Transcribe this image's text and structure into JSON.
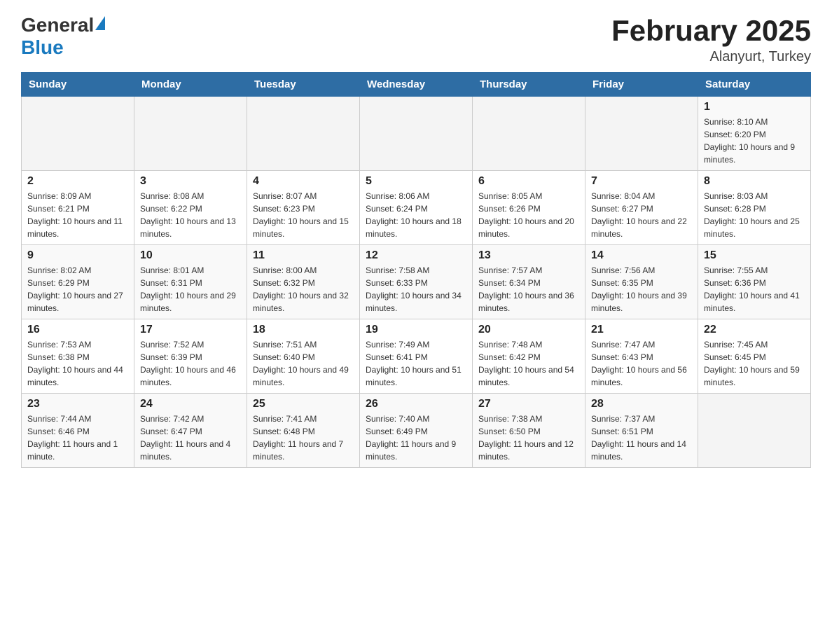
{
  "header": {
    "logo_general": "General",
    "logo_blue": "Blue",
    "title": "February 2025",
    "subtitle": "Alanyurt, Turkey"
  },
  "weekdays": [
    "Sunday",
    "Monday",
    "Tuesday",
    "Wednesday",
    "Thursday",
    "Friday",
    "Saturday"
  ],
  "weeks": [
    [
      {
        "day": "",
        "info": ""
      },
      {
        "day": "",
        "info": ""
      },
      {
        "day": "",
        "info": ""
      },
      {
        "day": "",
        "info": ""
      },
      {
        "day": "",
        "info": ""
      },
      {
        "day": "",
        "info": ""
      },
      {
        "day": "1",
        "info": "Sunrise: 8:10 AM\nSunset: 6:20 PM\nDaylight: 10 hours and 9 minutes."
      }
    ],
    [
      {
        "day": "2",
        "info": "Sunrise: 8:09 AM\nSunset: 6:21 PM\nDaylight: 10 hours and 11 minutes."
      },
      {
        "day": "3",
        "info": "Sunrise: 8:08 AM\nSunset: 6:22 PM\nDaylight: 10 hours and 13 minutes."
      },
      {
        "day": "4",
        "info": "Sunrise: 8:07 AM\nSunset: 6:23 PM\nDaylight: 10 hours and 15 minutes."
      },
      {
        "day": "5",
        "info": "Sunrise: 8:06 AM\nSunset: 6:24 PM\nDaylight: 10 hours and 18 minutes."
      },
      {
        "day": "6",
        "info": "Sunrise: 8:05 AM\nSunset: 6:26 PM\nDaylight: 10 hours and 20 minutes."
      },
      {
        "day": "7",
        "info": "Sunrise: 8:04 AM\nSunset: 6:27 PM\nDaylight: 10 hours and 22 minutes."
      },
      {
        "day": "8",
        "info": "Sunrise: 8:03 AM\nSunset: 6:28 PM\nDaylight: 10 hours and 25 minutes."
      }
    ],
    [
      {
        "day": "9",
        "info": "Sunrise: 8:02 AM\nSunset: 6:29 PM\nDaylight: 10 hours and 27 minutes."
      },
      {
        "day": "10",
        "info": "Sunrise: 8:01 AM\nSunset: 6:31 PM\nDaylight: 10 hours and 29 minutes."
      },
      {
        "day": "11",
        "info": "Sunrise: 8:00 AM\nSunset: 6:32 PM\nDaylight: 10 hours and 32 minutes."
      },
      {
        "day": "12",
        "info": "Sunrise: 7:58 AM\nSunset: 6:33 PM\nDaylight: 10 hours and 34 minutes."
      },
      {
        "day": "13",
        "info": "Sunrise: 7:57 AM\nSunset: 6:34 PM\nDaylight: 10 hours and 36 minutes."
      },
      {
        "day": "14",
        "info": "Sunrise: 7:56 AM\nSunset: 6:35 PM\nDaylight: 10 hours and 39 minutes."
      },
      {
        "day": "15",
        "info": "Sunrise: 7:55 AM\nSunset: 6:36 PM\nDaylight: 10 hours and 41 minutes."
      }
    ],
    [
      {
        "day": "16",
        "info": "Sunrise: 7:53 AM\nSunset: 6:38 PM\nDaylight: 10 hours and 44 minutes."
      },
      {
        "day": "17",
        "info": "Sunrise: 7:52 AM\nSunset: 6:39 PM\nDaylight: 10 hours and 46 minutes."
      },
      {
        "day": "18",
        "info": "Sunrise: 7:51 AM\nSunset: 6:40 PM\nDaylight: 10 hours and 49 minutes."
      },
      {
        "day": "19",
        "info": "Sunrise: 7:49 AM\nSunset: 6:41 PM\nDaylight: 10 hours and 51 minutes."
      },
      {
        "day": "20",
        "info": "Sunrise: 7:48 AM\nSunset: 6:42 PM\nDaylight: 10 hours and 54 minutes."
      },
      {
        "day": "21",
        "info": "Sunrise: 7:47 AM\nSunset: 6:43 PM\nDaylight: 10 hours and 56 minutes."
      },
      {
        "day": "22",
        "info": "Sunrise: 7:45 AM\nSunset: 6:45 PM\nDaylight: 10 hours and 59 minutes."
      }
    ],
    [
      {
        "day": "23",
        "info": "Sunrise: 7:44 AM\nSunset: 6:46 PM\nDaylight: 11 hours and 1 minute."
      },
      {
        "day": "24",
        "info": "Sunrise: 7:42 AM\nSunset: 6:47 PM\nDaylight: 11 hours and 4 minutes."
      },
      {
        "day": "25",
        "info": "Sunrise: 7:41 AM\nSunset: 6:48 PM\nDaylight: 11 hours and 7 minutes."
      },
      {
        "day": "26",
        "info": "Sunrise: 7:40 AM\nSunset: 6:49 PM\nDaylight: 11 hours and 9 minutes."
      },
      {
        "day": "27",
        "info": "Sunrise: 7:38 AM\nSunset: 6:50 PM\nDaylight: 11 hours and 12 minutes."
      },
      {
        "day": "28",
        "info": "Sunrise: 7:37 AM\nSunset: 6:51 PM\nDaylight: 11 hours and 14 minutes."
      },
      {
        "day": "",
        "info": ""
      }
    ]
  ]
}
